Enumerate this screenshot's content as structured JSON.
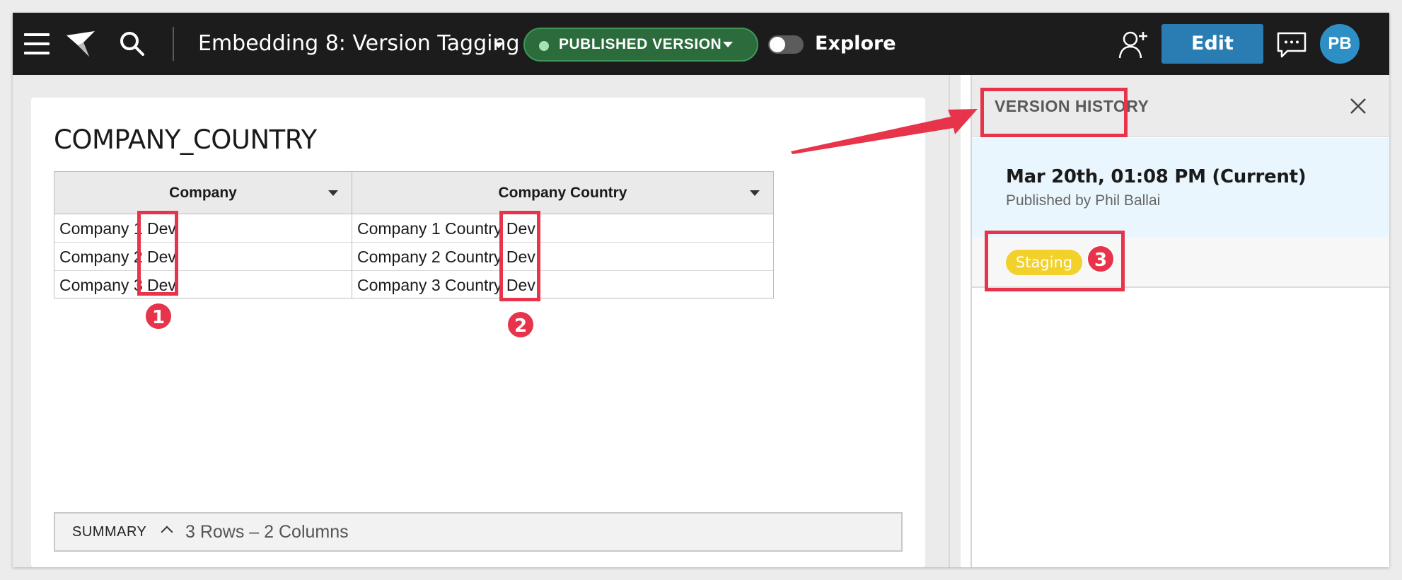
{
  "topbar": {
    "doc_title": "Embedding 8: Version Tagging",
    "published_label": "PUBLISHED VERSION",
    "explore_label": "Explore",
    "edit_label": "Edit",
    "avatar_initials": "PB",
    "icons": [
      "menu-icon",
      "sigma-logo",
      "search-icon",
      "add-user-icon",
      "chat-icon"
    ]
  },
  "card": {
    "title": "COMPANY_COUNTRY",
    "columns": [
      "Company",
      "Company Country"
    ],
    "rows": [
      [
        "Company 1 Dev",
        "Company 1 Country Dev"
      ],
      [
        "Company 2 Dev",
        "Company 2 Country Dev"
      ],
      [
        "Company 3 Dev",
        "Company 3 Country Dev"
      ]
    ],
    "summary_label": "SUMMARY",
    "summary_text": "3 Rows – 2 Columns"
  },
  "panel": {
    "title": "VERSION HISTORY",
    "version_date": "Mar 20th, 01:08 PM (Current)",
    "published_by": "Published by Phil Ballai",
    "tag": "Staging"
  },
  "annotations": {
    "badges": [
      "1",
      "2",
      "3"
    ]
  },
  "colors": {
    "topbar": "#1c1c1c",
    "published_pill": "#2b6b3c",
    "edit_button": "#2a7db3",
    "avatar": "#2e8fc7",
    "staging_tag": "#f3d12b",
    "annotation_red": "#e8344a",
    "current_version_bg": "#eaf6fd"
  }
}
